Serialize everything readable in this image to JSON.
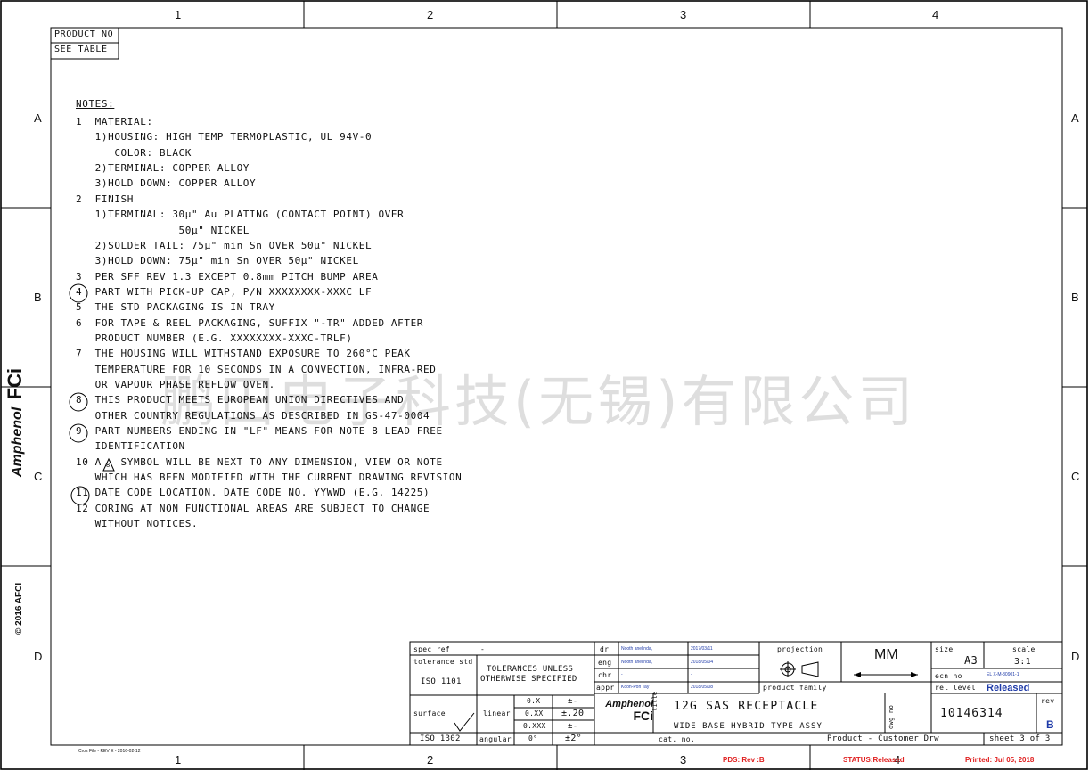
{
  "frame": {
    "col_labels": [
      "1",
      "2",
      "3",
      "4"
    ],
    "row_labels": [
      "A",
      "B",
      "C",
      "D"
    ],
    "cross_file": "Cros File - REV E - 2016-02-12"
  },
  "product_box": {
    "line1": "PRODUCT NO",
    "line2": "SEE TABLE"
  },
  "notes": {
    "heading": "NOTES:",
    "lines": [
      "1  MATERIAL:",
      "   1)HOUSING: HIGH TEMP TERMOPLASTIC, UL 94V-0",
      "      COLOR: BLACK",
      "   2)TERMINAL: COPPER ALLOY",
      "   3)HOLD DOWN: COPPER ALLOY",
      "2  FINISH",
      "   1)TERMINAL: 30μ\" Au PLATING (CONTACT POINT) OVER",
      "                50μ\" NICKEL",
      "   2)SOLDER TAIL: 75μ\" min Sn OVER 50μ\" NICKEL",
      "   3)HOLD DOWN: 75μ\" min Sn OVER 50μ\" NICKEL",
      "3  PER SFF REV 1.3 EXCEPT 0.8mm PITCH BUMP AREA",
      "4  PART WITH PICK-UP CAP, P/N XXXXXXXX-XXXC LF",
      "5  THE STD PACKAGING IS IN TRAY",
      "6  FOR TAPE & REEL PACKAGING, SUFFIX \"-TR\" ADDED AFTER",
      "   PRODUCT NUMBER (E.G. XXXXXXXX-XXXC-TRLF)",
      "7  THE HOUSING WILL WITHSTAND EXPOSURE TO 260°C PEAK",
      "   TEMPERATURE FOR 10 SECONDS IN A CONVECTION, INFRA-RED",
      "   OR VAPOUR PHASE REFLOW OVEN.",
      "8  THIS PRODUCT MEETS EUROPEAN UNION DIRECTIVES AND",
      "   OTHER COUNTRY REGULATIONS AS DESCRIBED IN GS-47-0004",
      "9  PART NUMBERS ENDING IN \"LF\" MEANS FOR NOTE 8 LEAD FREE",
      "   IDENTIFICATION",
      "10 A   SYMBOL WILL BE NEXT TO ANY DIMENSION, VIEW OR NOTE",
      "   WHICH HAS BEEN MODIFIED WITH THE CURRENT DRAWING REVISION",
      "11 DATE CODE LOCATION. DATE CODE NO. YYWWD (E.G. 14225)",
      "12 CORING AT NON FUNCTIONAL AREAS ARE SUBJECT TO CHANGE",
      "   WITHOUT NOTICES."
    ],
    "circled_notes": [
      "4",
      "8",
      "9",
      "11"
    ],
    "delta_symbol": "8"
  },
  "watermark": "鹏田电子科技(无锡)有限公司",
  "side_logo": {
    "line1": "Amphenol",
    "line2": "FCi",
    "copyright": "© 2016 AFCI"
  },
  "title_block": {
    "spec_ref_label": "spec ref",
    "spec_ref_value": "-",
    "tolerance_std_label": "tolerance std",
    "tolerance_std_value": "ISO 1101",
    "tolerance_note_1": "TOLERANCES UNLESS",
    "tolerance_note_2": "OTHERWISE SPECIFIED",
    "surface_label": "surface",
    "surface_std": "ISO 1302",
    "linear_label": "linear",
    "angular_label": "angular",
    "tol_rows": [
      {
        "dim": "0.X",
        "tol": "±-"
      },
      {
        "dim": "0.XX",
        "tol": "±.20"
      },
      {
        "dim": "0.XXX",
        "tol": "±-"
      },
      {
        "dim": "0°",
        "tol": "±2°"
      }
    ],
    "roles": [
      {
        "role": "dr",
        "name": "Nooth anelinda,",
        "date": "2017/03/11"
      },
      {
        "role": "eng",
        "name": "Nooth anelinda,",
        "date": "2018/05/04"
      },
      {
        "role": "chr",
        "name": "-",
        "date": "-"
      },
      {
        "role": "appr",
        "name": "Koon-Poh Tay",
        "date": "2018/05/08"
      }
    ],
    "projection_label": "projection",
    "units": "MM",
    "product_family_label": "product family",
    "size_label": "size",
    "size_value": "A3",
    "scale_label": "scale",
    "scale_value": "3:1",
    "ecn_label": "ecn no",
    "ecn_value": "EL X-M-30901-1",
    "rel_level_label": "rel level",
    "rel_level_value": "Released",
    "title_label": "title",
    "title_line1": "12G SAS RECEPTACLE",
    "title_line2": "WIDE BASE HYBRID TYPE ASSY",
    "dwg_label": "dwg no",
    "dwg_no": "10146314",
    "rev_label": "rev",
    "rev_value": "B",
    "cat_label": "cat. no.",
    "product_drw": "Product - Customer Drw",
    "sheet": "sheet 3 of 3",
    "logo_line1": "Amphenol",
    "logo_line2": "FCi"
  },
  "footer": {
    "pds": "PDS: Rev :B",
    "status": "STATUS:Released",
    "printed": "Printed:  Jul 05, 2018"
  },
  "colors": {
    "line": "#000000",
    "status_red": "#e02020",
    "release_blue": "#1e3aa8"
  }
}
